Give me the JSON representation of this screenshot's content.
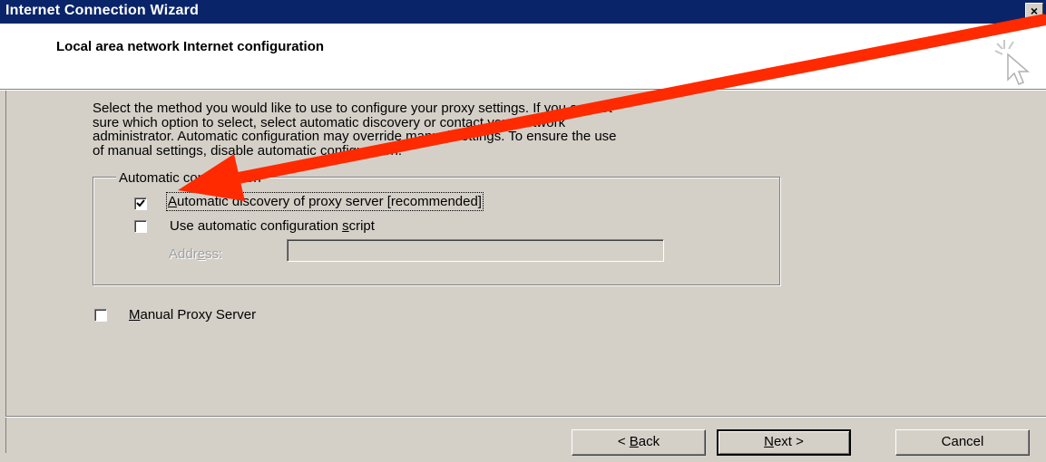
{
  "window": {
    "title": "Internet Connection Wizard",
    "close_glyph": "×"
  },
  "header": {
    "title": "Local area network Internet configuration",
    "icon": "cursor-sparkle-icon"
  },
  "description": {
    "line1": "Select the method you would like to use to configure your proxy settings.  If you are not",
    "line2": "sure which option to select, select automatic discovery or contact your network",
    "line3": "administrator.  Automatic configuration may override manual settings.  To ensure the use",
    "line4": "of manual settings, disable automatic configuration."
  },
  "auto_config": {
    "group_label": "Automatic configuration",
    "auto_discovery": {
      "label_pre": "",
      "label_key": "A",
      "label_post": "utomatic discovery of proxy server [recommended]",
      "checked": true
    },
    "auto_script": {
      "label_pre": "Use automatic configuration ",
      "label_key": "s",
      "label_post": "cript",
      "checked": false
    },
    "address": {
      "label_pre": "Addr",
      "label_key": "e",
      "label_post": "ss:",
      "value": "",
      "enabled": false
    }
  },
  "manual_proxy": {
    "label_pre": "",
    "label_key": "M",
    "label_post": "anual Proxy Server",
    "checked": false
  },
  "buttons": {
    "back": {
      "pre": "< ",
      "key": "B",
      "post": "ack"
    },
    "next": {
      "pre": "",
      "key": "N",
      "post": "ext >"
    },
    "cancel": {
      "label": "Cancel"
    }
  },
  "annotation": {
    "arrow_color": "#ff2a00",
    "icon": "red-arrow-annotation"
  },
  "colors": {
    "titlebar": "#0a246a",
    "dialog_face": "#d4d0c8"
  }
}
